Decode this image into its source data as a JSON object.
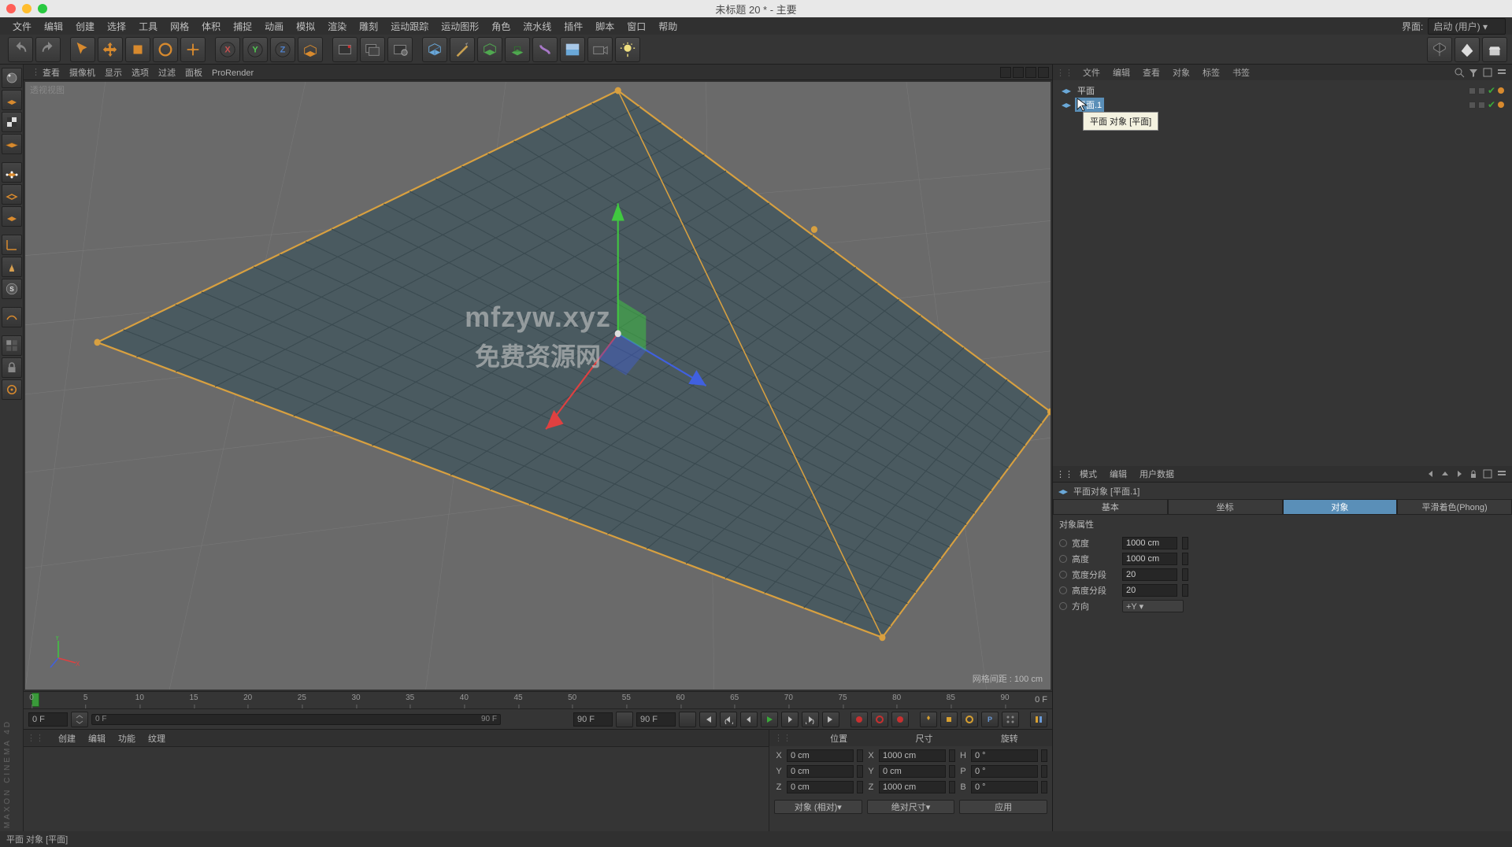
{
  "window": {
    "title": "未标题 20 * - 主要"
  },
  "topbar": {
    "menus": [
      "文件",
      "编辑",
      "创建",
      "选择",
      "工具",
      "网格",
      "体积",
      "捕捉",
      "动画",
      "模拟",
      "渲染",
      "雕刻",
      "运动跟踪",
      "运动图形",
      "角色",
      "流水线",
      "插件",
      "脚本",
      "窗口",
      "帮助"
    ],
    "right_label": "界面:",
    "layout": "启动 (用户)"
  },
  "vp_header": {
    "tabs": [
      "查看",
      "摄像机",
      "显示",
      "选项",
      "过滤",
      "面板",
      "ProRender"
    ]
  },
  "viewport": {
    "title": "透视视图",
    "grid_info": "网格间距 : 100 cm"
  },
  "watermark": {
    "line1": "mfzyw.xyz",
    "line2": "免费资源网"
  },
  "timeline": {
    "ticks": [
      "0",
      "5",
      "10",
      "15",
      "20",
      "25",
      "30",
      "35",
      "40",
      "45",
      "50",
      "55",
      "60",
      "65",
      "70",
      "75",
      "80",
      "85",
      "90"
    ],
    "end_label": "0 F"
  },
  "transport": {
    "start": "0 F",
    "range_start": "0 F",
    "range_end": "90 F",
    "current": "90 F"
  },
  "material_menus": [
    "创建",
    "编辑",
    "功能",
    "纹理"
  ],
  "coord": {
    "heads": [
      "位置",
      "尺寸",
      "旋转"
    ],
    "rows": [
      {
        "a": "X",
        "p": "0 cm",
        "sl": "X",
        "s": "1000 cm",
        "rl": "H",
        "r": "0 °"
      },
      {
        "a": "Y",
        "p": "0 cm",
        "sl": "Y",
        "s": "0 cm",
        "rl": "P",
        "r": "0 °"
      },
      {
        "a": "Z",
        "p": "0 cm",
        "sl": "Z",
        "s": "1000 cm",
        "rl": "B",
        "r": "0 °"
      }
    ],
    "mode1": "对象 (相对)",
    "mode2": "绝对尺寸",
    "apply": "应用"
  },
  "obj_panel": {
    "menus": [
      "文件",
      "编辑",
      "查看",
      "对象",
      "标签",
      "书签"
    ],
    "items": [
      {
        "name": "平面.1",
        "sel": true
      },
      {
        "name": "平面",
        "sel": false
      }
    ],
    "tooltip": "平面 对象 [平面]"
  },
  "attr_panel": {
    "menus": [
      "模式",
      "编辑",
      "用户数据"
    ],
    "title": "平面对象 [平面.1]",
    "tabs": [
      "基本",
      "坐标",
      "对象",
      "平滑着色(Phong)"
    ],
    "active_tab": 2,
    "section": "对象属性",
    "props": [
      {
        "label": "宽度",
        "value": "1000 cm"
      },
      {
        "label": "高度",
        "value": "1000 cm"
      },
      {
        "label": "宽度分段",
        "value": "20"
      },
      {
        "label": "高度分段",
        "value": "20"
      }
    ],
    "orientation_label": "方向",
    "orientation_value": "+Y"
  },
  "status": {
    "text": "平面 对象 [平面]"
  },
  "logo": "MAXON  CINEMA 4D"
}
